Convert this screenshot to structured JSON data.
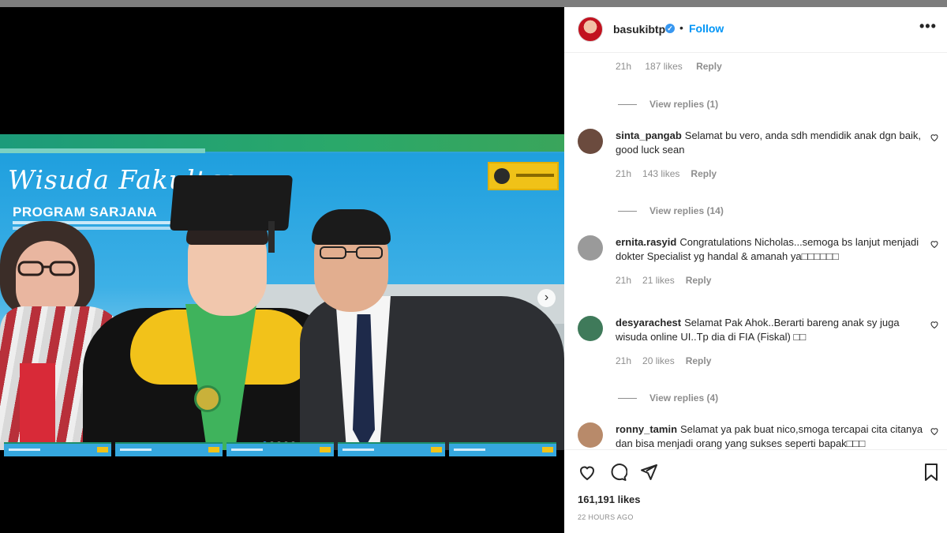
{
  "post": {
    "username": "basukibtp",
    "follow_label": "Follow",
    "separator": "•",
    "more_label": "•••",
    "verified_badge": "✓",
    "likes": "161,191 likes",
    "time_ago": "22 HOURS AGO"
  },
  "media": {
    "title_script": "Wisuda Fakultas",
    "title_program": "PROGRAM SARJANA",
    "next_icon": "›",
    "carousel_count": 5,
    "carousel_active_index": 0
  },
  "top_comment_meta": {
    "time": "21h",
    "likes": "187 likes",
    "reply": "Reply"
  },
  "comments": [
    {
      "view_replies": "View replies (1)"
    },
    {
      "username": "sinta_pangab",
      "text": "Selamat bu vero, anda sdh mendidik anak dgn baik, good luck sean",
      "time": "21h",
      "likes": "143 likes",
      "reply": "Reply",
      "avatar_color": "#6b4b3e",
      "view_replies": "View replies (14)"
    },
    {
      "username": "ernita.rasyid",
      "text": "Congratulations Nicholas...semoga bs lanjut menjadi dokter Specialist yg handal & amanah ya□□□□□□",
      "time": "21h",
      "likes": "21 likes",
      "reply": "Reply",
      "avatar_color": "#9a9a9a"
    },
    {
      "username": "desyarachest",
      "text": "Selamat Pak Ahok..Berarti bareng anak sy juga wisuda online UI..Tp dia di FIA (Fiskal) □□",
      "time": "21h",
      "likes": "20 likes",
      "reply": "Reply",
      "avatar_color": "#3f7a5a",
      "view_replies": "View replies (4)"
    },
    {
      "username": "ronny_tamin",
      "text": "Selamat ya pak buat nico,smoga tercapai cita citanya dan bisa menjadi orang yang sukses seperti bapak□□□",
      "avatar_color": "#b88a6a"
    }
  ],
  "icons": {
    "heart": "heart-icon",
    "comment": "comment-icon",
    "share": "share-icon",
    "save": "bookmark-icon",
    "next": "chevron-right-icon",
    "more": "more-options-icon",
    "verified": "verified-badge-icon"
  },
  "colors": {
    "follow": "#0095f6",
    "verified": "#3897f0",
    "muted": "#8e8e8e",
    "text": "#262626"
  }
}
